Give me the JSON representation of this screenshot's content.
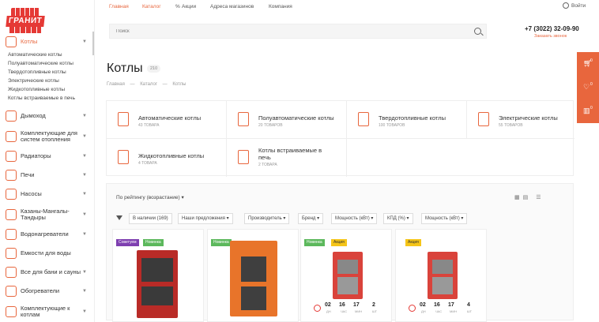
{
  "logo": {
    "text": "ГРАНИТ"
  },
  "topnav": {
    "items": [
      "Главная",
      "Каталог",
      "Акции",
      "Адреса магазинов",
      "Компания"
    ],
    "login": "Войти"
  },
  "search": {
    "placeholder": "Поиск"
  },
  "contact": {
    "phone": "+7 (3022) 32-09-90",
    "callback": "Заказать звонок"
  },
  "floatbar": {
    "counts": [
      "0",
      "0",
      "0"
    ]
  },
  "sidebar": {
    "active": {
      "label": "Котлы"
    },
    "subitems": [
      "Автоматические котлы",
      "Полуавтоматические котлы",
      "Твердотопливные котлы",
      "Электрические котлы",
      "Жидкотопливные котлы",
      "Котлы встраиваемые в печь"
    ],
    "items": [
      {
        "label": "Дымоход",
        "arrow": true
      },
      {
        "label": "Комплектующие для систем отопления",
        "arrow": true
      },
      {
        "label": "Радиаторы",
        "arrow": true
      },
      {
        "label": "Печи",
        "arrow": true
      },
      {
        "label": "Насосы",
        "arrow": true
      },
      {
        "label": "Казаны-Мангалы-Тандыры",
        "arrow": true
      },
      {
        "label": "Водонагреватели",
        "arrow": true
      },
      {
        "label": "Емкости для воды",
        "arrow": false
      },
      {
        "label": "Все для бани и сауны",
        "arrow": true
      },
      {
        "label": "Обогреватели",
        "arrow": true
      },
      {
        "label": "Комплектующие к котлам",
        "arrow": true
      }
    ]
  },
  "page": {
    "title": "Котлы",
    "count": "210",
    "breadcrumb": [
      "Главная",
      "—",
      "Каталог",
      "—",
      "Котлы"
    ]
  },
  "categories": [
    {
      "name": "Автоматические котлы",
      "count": "43 ТОВАРА"
    },
    {
      "name": "Полуавтоматические котлы",
      "count": "20 ТОВАРОВ"
    },
    {
      "name": "Твердотопливные котлы",
      "count": "100 ТОВАРОВ"
    },
    {
      "name": "Электрические котлы",
      "count": "55 ТОВАРОВ"
    },
    {
      "name": "Жидкотопливные котлы",
      "count": "4 ТОВАРА"
    },
    {
      "name": "Котлы встраиваемые в печь",
      "count": "2 ТОВАРА"
    }
  ],
  "sorting": {
    "label": "По рейтингу (возрастание)"
  },
  "filters": [
    "В наличии (169)",
    "Наши предложения",
    "Производитель",
    "Бренд",
    "Мощность (кВт)",
    "КПД (%)",
    "Мощность (кВт)"
  ],
  "products": [
    {
      "tags": [
        {
          "text": "Советуем",
          "color": "#7e3fb0"
        },
        {
          "text": "Новинка",
          "color": "#5cb85c"
        }
      ],
      "timer": null
    },
    {
      "tags": [
        {
          "text": "Новинка",
          "color": "#5cb85c"
        }
      ],
      "timer": null
    },
    {
      "tags": [
        {
          "text": "Новинка",
          "color": "#5cb85c"
        },
        {
          "text": "Акция",
          "color": "#f5c518"
        }
      ],
      "timer": {
        "days": "02",
        "hours": "16",
        "minutes": "17",
        "count": "2",
        "units": [
          "ДН",
          "ЧАС",
          "МИН",
          "ШТ"
        ]
      }
    },
    {
      "tags": [
        {
          "text": "Акция",
          "color": "#f5c518"
        }
      ],
      "timer": {
        "days": "02",
        "hours": "16",
        "minutes": "17",
        "count": "4",
        "units": [
          "ДН",
          "ЧАС",
          "МИН",
          "ШТ"
        ]
      }
    }
  ],
  "colors": {
    "accent": "#e8663d",
    "brand": "#e53935"
  }
}
